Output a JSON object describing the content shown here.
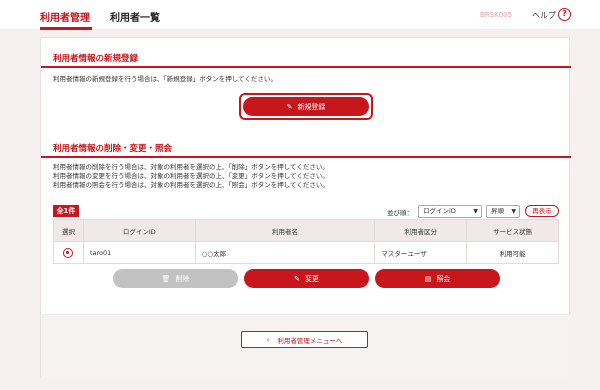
{
  "header": {
    "brand": "利用者管理",
    "page_title": "利用者一覧",
    "screen_code": "BRSK005",
    "help_label": "ヘルプ",
    "help_icon": "question-icon"
  },
  "register": {
    "title": "利用者情報の新規登録",
    "description": "利用者情報の新規登録を行う場合は、「新規登録」ボタンを押してください。",
    "button_label": "新規登録"
  },
  "manage": {
    "title": "利用者情報の削除・変更・照会",
    "description_lines": [
      "利用者情報の削除を行う場合は、対象の利用者を選択の上、「削除」ボタンを押してください。",
      "利用者情報の変更を行う場合は、対象の利用者を選択の上、「変更」ボタンを押してください。",
      "利用者情報の照会を行う場合は、対象の利用者を選択の上、「照会」ボタンを押してください。"
    ],
    "count_label": "全1件",
    "sort_label": "並び順：",
    "sort_key": "ログインID",
    "sort_order": "昇順",
    "redisplay_label": "再表示",
    "columns": [
      "選択",
      "ログインID",
      "利用者名",
      "利用者区分",
      "サービス状態"
    ],
    "rows": [
      {
        "login_id": "taro01",
        "name": "○○太郎",
        "category": "マスターユーザ",
        "status": "利用可能"
      }
    ],
    "delete_label": "削除",
    "edit_label": "変更",
    "view_label": "照会"
  },
  "footer": {
    "back_label": "利用者管理メニューへ"
  },
  "colors": {
    "accent": "#c8161d",
    "disabled": "#c2c2c2"
  }
}
